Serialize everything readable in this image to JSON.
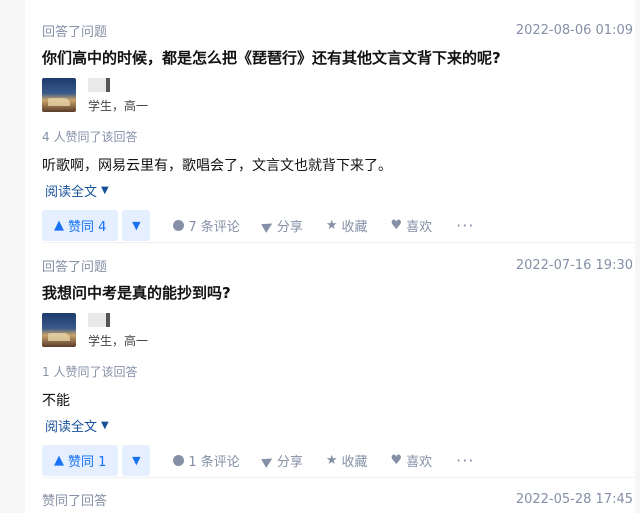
{
  "feed": {
    "items": [
      {
        "action": "回答了问题",
        "time": "2022-08-06 01:09",
        "question": "你们高中的时候，都是怎么把《琵琶行》还有其他文言文背下来的呢?",
        "headline": "学生，高一",
        "voters": "4 人赞同了该回答",
        "content": "听歌啊，网易云里有，歌唱会了，文言文也就背下来了。",
        "read_more": "阅读全文",
        "vote_up": "赞同 4",
        "comments": "7 条评论",
        "share": "分享",
        "collect": "收藏",
        "like": "喜欢",
        "more": "···"
      },
      {
        "action": "回答了问题",
        "time": "2022-07-16 19:30",
        "question": "我想问中考是真的能抄到吗?",
        "headline": "学生，高一",
        "voters": "1 人赞同了该回答",
        "content": "不能",
        "read_more": "阅读全文",
        "vote_up": "赞同 1",
        "comments": "1 条评论",
        "share": "分享",
        "collect": "收藏",
        "like": "喜欢",
        "more": "···"
      },
      {
        "action": "赞同了回答",
        "time": "2022-05-28 17:45"
      }
    ]
  },
  "icons": {
    "read_more": "chevron-down-icon",
    "vote_up": "triangle-up-icon",
    "vote_down": "triangle-down-icon",
    "comment": "comment-icon",
    "share": "share-icon",
    "collect": "star-icon",
    "like": "heart-icon",
    "more": "more-icon"
  },
  "colors": {
    "primary": "#1772f6",
    "vote_bg": "#e5efff",
    "muted": "#8590a6",
    "link": "#175199"
  }
}
